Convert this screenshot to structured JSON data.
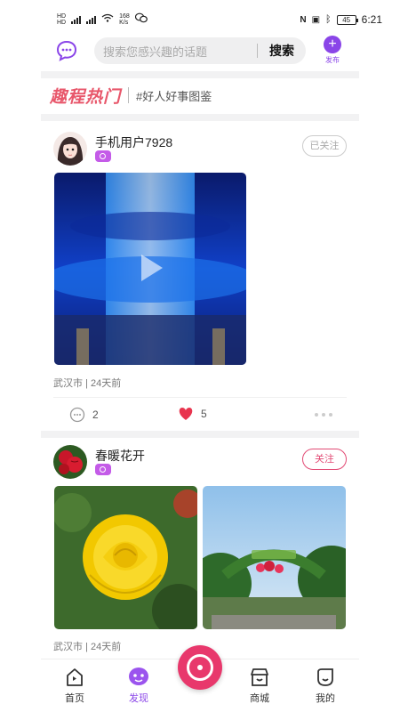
{
  "status_bar": {
    "network_speed": "168\nK/s",
    "battery": "45",
    "time": "6:21"
  },
  "search": {
    "placeholder": "搜索您感兴趣的话题",
    "button": "搜索"
  },
  "publish": {
    "label": "发布"
  },
  "banner": {
    "brand": "趣程热门",
    "tag": "#好人好事图鉴"
  },
  "posts": [
    {
      "user": "手机用户7928",
      "follow_label": "已关注",
      "location": "武汉市 | 24天前",
      "comments": "2",
      "likes": "5"
    },
    {
      "user": "春暖花开",
      "follow_label": "关注",
      "location": "武汉市 | 24天前"
    }
  ],
  "nav": {
    "items": [
      {
        "label": "首页",
        "icon": "home-icon"
      },
      {
        "label": "发现",
        "icon": "discover-icon"
      },
      {
        "label": "",
        "icon": "camera-icon"
      },
      {
        "label": "商城",
        "icon": "shop-icon"
      },
      {
        "label": "我的",
        "icon": "profile-icon"
      }
    ]
  },
  "colors": {
    "accent": "#8a45e8",
    "brand": "#e8576b",
    "like": "#e8344e",
    "follow": "#e24a74"
  }
}
